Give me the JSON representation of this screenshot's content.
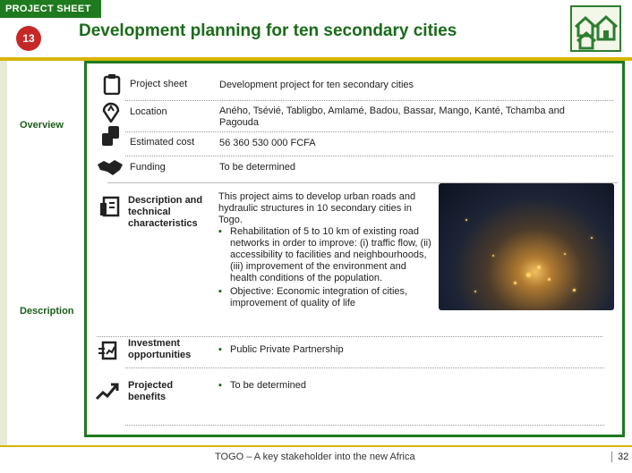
{
  "header": {
    "tag": "PROJECT SHEET",
    "number": "13",
    "title": "Development planning for ten secondary cities"
  },
  "sections": {
    "overview": "Overview",
    "description": "Description"
  },
  "overview_rows": [
    {
      "label": "Project sheet",
      "value": "Development project for ten secondary cities",
      "icon": "clipboard-icon"
    },
    {
      "label": "Location",
      "value": "Aného, Tsévié, Tabligbo, Amlamé, Badou, Bassar, Mango, Kanté, Tchamba and  Pagouda",
      "icon": "location-pin-icon"
    },
    {
      "label": "Estimated cost",
      "value": "56 360 530 000 FCFA",
      "icon": "coins-icon"
    },
    {
      "label": "Funding",
      "value": "To be determined",
      "icon": "handshake-icon"
    }
  ],
  "description": {
    "label": "Description and technical characteristics",
    "intro": "This project aims to develop urban roads and hydraulic structures in 10 secondary cities in Togo.",
    "bullets": [
      "Rehabilitation of 5 to 10 km of existing road networks in order to improve: (i) traffic flow, (ii) accessibility to facilities and neighbourhoods, (iii) improvement of the environment and health conditions of the population.",
      "Objective: Economic integration of cities, improvement of quality of life"
    ]
  },
  "investment": {
    "label": "Investment opportunities",
    "value": "Public Private Partnership",
    "icon": "document-chart-icon"
  },
  "benefits": {
    "label": "Projected benefits",
    "value": "To be determined",
    "icon": "growth-chart-icon"
  },
  "footer": {
    "text": "TOGO – A key stakeholder into the new Africa",
    "page": "32"
  },
  "colors": {
    "brand_green": "#1f7a1f",
    "accent_yellow": "#d6b400",
    "badge_red": "#c62828"
  }
}
